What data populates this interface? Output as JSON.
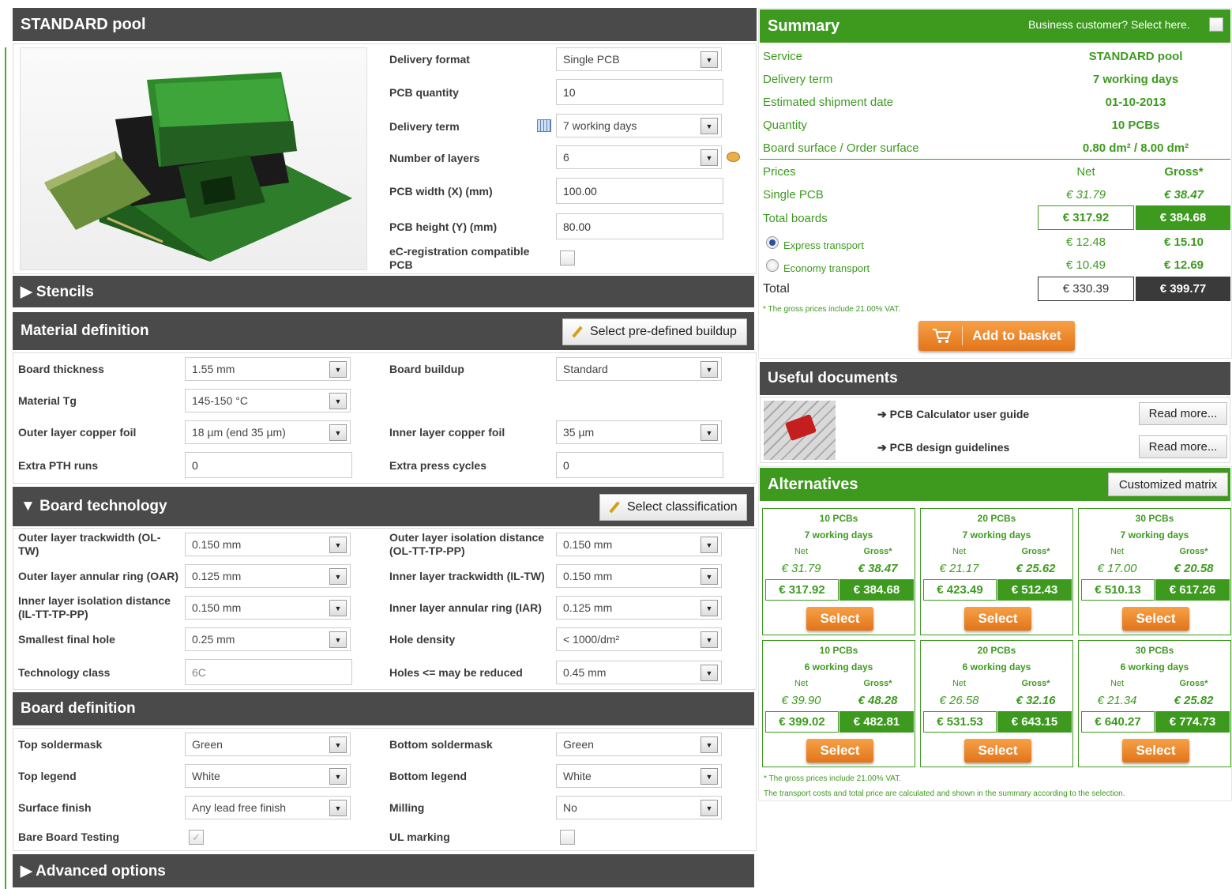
{
  "left": {
    "header": "STANDARD pool",
    "delivery_format_label": "Delivery format",
    "delivery_format_value": "Single PCB",
    "pcb_quantity_label": "PCB quantity",
    "pcb_quantity_value": "10",
    "delivery_term_label": "Delivery term",
    "delivery_term_value": "7 working days",
    "layers_label": "Number of layers",
    "layers_value": "6",
    "width_label": "PCB width (X) (mm)",
    "width_value": "100.00",
    "height_label": "PCB height (Y) (mm)",
    "height_value": "80.00",
    "ec_label": "eC-registration compatible PCB",
    "stencils": "▶ Stencils",
    "material": {
      "title": "Material definition",
      "predefined_btn": "Select pre-defined buildup",
      "board_thickness_label": "Board thickness",
      "board_thickness_value": "1.55 mm",
      "material_tg_label": "Material Tg",
      "material_tg_value": "145-150 °C",
      "outer_copper_label": "Outer layer copper foil",
      "outer_copper_value": "18 µm (end 35 µm)",
      "extra_pth_label": "Extra PTH runs",
      "extra_pth_value": "0",
      "board_buildup_label": "Board buildup",
      "board_buildup_value": "Standard",
      "inner_copper_label": "Inner layer copper foil",
      "inner_copper_value": "35 µm",
      "extra_press_label": "Extra press cycles",
      "extra_press_value": "0"
    },
    "technology": {
      "title": "▼ Board technology",
      "classification_btn": "Select classification",
      "ol_tw_label": "Outer layer trackwidth (OL-TW)",
      "ol_tw_value": "0.150 mm",
      "oar_label": "Outer layer annular ring (OAR)",
      "oar_value": "0.125 mm",
      "il_iso_label": "Inner layer isolation distance (IL-TT-TP-PP)",
      "il_iso_value": "0.150 mm",
      "smallest_hole_label": "Smallest final hole",
      "smallest_hole_value": "0.25 mm",
      "tech_class_label": "Technology class",
      "tech_class_value": "6C",
      "ol_iso_label": "Outer layer isolation distance (OL-TT-TP-PP)",
      "ol_iso_value": "0.150 mm",
      "il_tw_label": "Inner layer trackwidth (IL-TW)",
      "il_tw_value": "0.150 mm",
      "iar_label": "Inner layer annular ring (IAR)",
      "iar_value": "0.125 mm",
      "hole_density_label": "Hole density",
      "hole_density_value": "< 1000/dm²",
      "holes_reduced_label": "Holes <= may be reduced",
      "holes_reduced_value": "0.45 mm"
    },
    "definition": {
      "title": "Board definition",
      "top_mask_label": "Top soldermask",
      "top_mask_value": "Green",
      "top_legend_label": "Top legend",
      "top_legend_value": "White",
      "surface_label": "Surface finish",
      "surface_value": "Any lead free finish",
      "bare_label": "Bare Board Testing",
      "bottom_mask_label": "Bottom soldermask",
      "bottom_mask_value": "Green",
      "bottom_legend_label": "Bottom legend",
      "bottom_legend_value": "White",
      "milling_label": "Milling",
      "milling_value": "No",
      "ul_label": "UL marking"
    },
    "advanced": "▶ Advanced options"
  },
  "summary": {
    "title": "Summary",
    "business": "Business customer? Select here.",
    "rows": [
      {
        "label": "Service",
        "value": "STANDARD pool"
      },
      {
        "label": "Delivery term",
        "value": "7 working days"
      },
      {
        "label": "Estimated shipment date",
        "value": "01-10-2013"
      },
      {
        "label": "Quantity",
        "value": "10 PCBs"
      },
      {
        "label": "Board surface / Order surface",
        "value": "0.80 dm² / 8.00 dm²"
      }
    ],
    "prices_label": "Prices",
    "net_label": "Net",
    "gross_label": "Gross*",
    "single_label": "Single PCB",
    "single_net": "€ 31.79",
    "single_gross": "€ 38.47",
    "total_boards_label": "Total boards",
    "total_boards_net": "€ 317.92",
    "total_boards_gross": "€ 384.68",
    "express_label": "Express transport",
    "express_net": "€ 12.48",
    "express_gross": "€ 15.10",
    "economy_label": "Economy transport",
    "economy_net": "€ 10.49",
    "economy_gross": "€ 12.69",
    "total_label": "Total",
    "total_net": "€ 330.39",
    "total_gross": "€ 399.77",
    "vat_note": "* The gross prices include 21.00% VAT.",
    "basket_btn": "Add to basket"
  },
  "documents": {
    "title": "Useful documents",
    "items": [
      {
        "label": "➔ PCB Calculator user guide",
        "btn": "Read more..."
      },
      {
        "label": "➔ PCB design guidelines",
        "btn": "Read more..."
      }
    ]
  },
  "alternatives": {
    "title": "Alternatives",
    "matrix_btn": "Customized matrix",
    "net_label": "Net",
    "gross_label": "Gross*",
    "select_label": "Select",
    "cards": [
      {
        "qty": "10 PCBs",
        "days": "7 working days",
        "net": "€ 31.79",
        "gross": "€ 38.47",
        "tnet": "€ 317.92",
        "tgross": "€ 384.68"
      },
      {
        "qty": "20 PCBs",
        "days": "7 working days",
        "net": "€ 21.17",
        "gross": "€ 25.62",
        "tnet": "€ 423.49",
        "tgross": "€ 512.43"
      },
      {
        "qty": "30 PCBs",
        "days": "7 working days",
        "net": "€ 17.00",
        "gross": "€ 20.58",
        "tnet": "€ 510.13",
        "tgross": "€ 617.26"
      },
      {
        "qty": "10 PCBs",
        "days": "6 working days",
        "net": "€ 39.90",
        "gross": "€ 48.28",
        "tnet": "€ 399.02",
        "tgross": "€ 482.81"
      },
      {
        "qty": "20 PCBs",
        "days": "6 working days",
        "net": "€ 26.58",
        "gross": "€ 32.16",
        "tnet": "€ 531.53",
        "tgross": "€ 643.15"
      },
      {
        "qty": "30 PCBs",
        "days": "6 working days",
        "net": "€ 21.34",
        "gross": "€ 25.82",
        "tnet": "€ 640.27",
        "tgross": "€ 774.73"
      }
    ],
    "note1": "* The gross prices include 21.00% VAT.",
    "note2": "The transport costs and total price are calculated and shown in the summary according to the selection."
  },
  "colors": {
    "green": "#3d9a1f",
    "dark": "#4a4a4a",
    "orange": "#e9822a"
  }
}
